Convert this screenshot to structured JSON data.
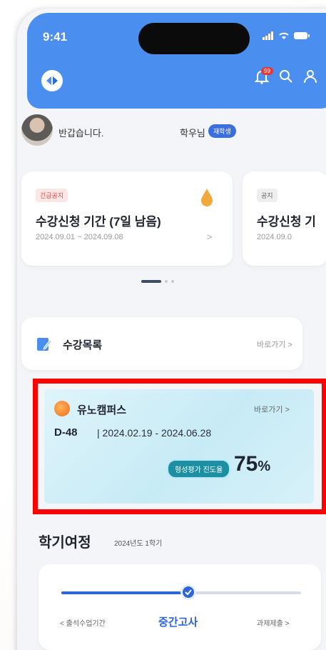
{
  "status": {
    "time": "9:41"
  },
  "header": {
    "notification_count": "99"
  },
  "greeting": {
    "text": "반갑습니다.",
    "name": "학우님",
    "role_badge": "재학생"
  },
  "notices": [
    {
      "tag": "긴급공지",
      "title": "수강신청 기간 (7일 남음)",
      "dates": "2024.09.01 ~ 2024.09.08",
      "chevron": ">"
    },
    {
      "tag": "공지",
      "title": "수강신청 기",
      "dates": "2024.09.0"
    }
  ],
  "carousel": {
    "pages": 3,
    "active": 0
  },
  "course_list": {
    "label": "수강목록",
    "go": "바로가기 >"
  },
  "campus": {
    "name": "유노캠퍼스",
    "go": "바로가기 >",
    "dday": "D-48",
    "period": "| 2024.02.19 - 2024.06.28",
    "progress_label": "형성평가 진도율",
    "progress_value": "75",
    "progress_unit": "%"
  },
  "semester": {
    "title": "학기여정",
    "subtitle": "2024년도 1학기",
    "progress": 0.53,
    "prev": "< 출석수업기간",
    "current": "중간고사",
    "next": "과제제출 >"
  },
  "colors": {
    "primary": "#4a8ef0",
    "accent": "#2f66d6",
    "highlight": "#ff0000",
    "urgent": "#e24b4b"
  }
}
